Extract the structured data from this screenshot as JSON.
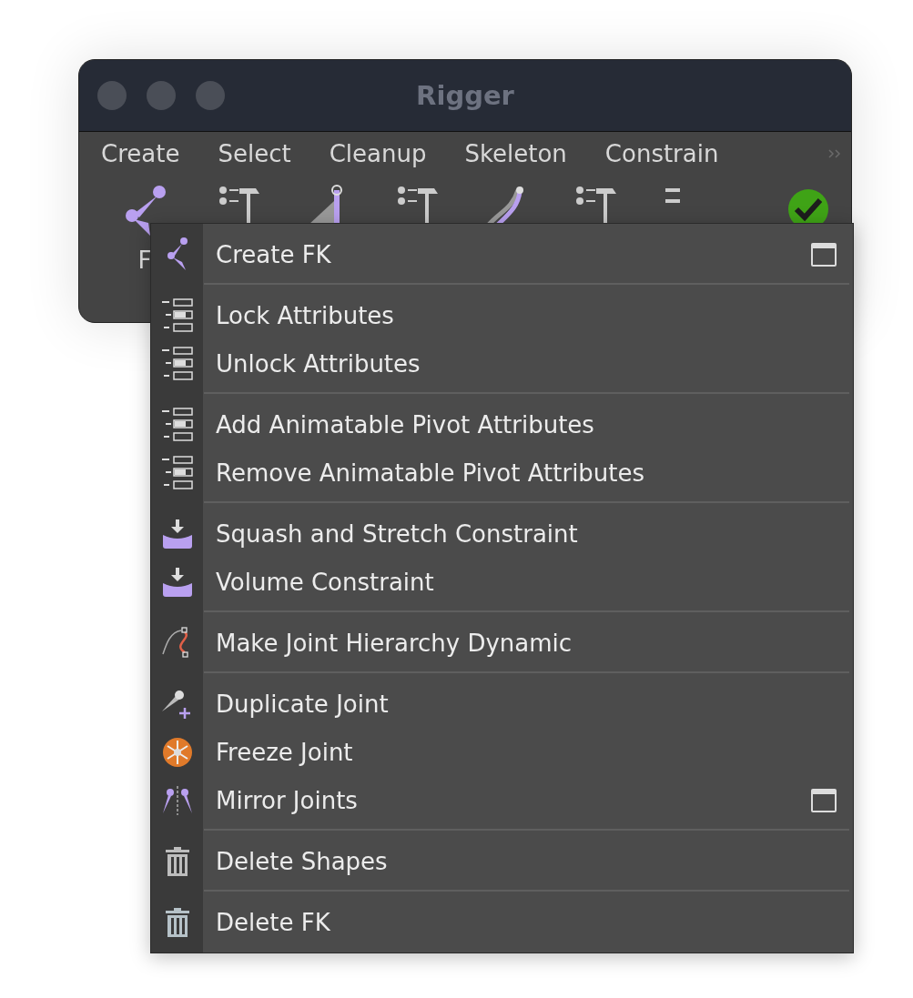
{
  "window": {
    "title": "Rigger"
  },
  "menu_bar": [
    "Create",
    "Select",
    "Cleanup",
    "Skeleton",
    "Constrain"
  ],
  "shelf": {
    "tools": [
      {
        "kind": "joint-chain",
        "label": "F"
      },
      {
        "kind": "attribute-tool"
      },
      {
        "kind": "joint-bone"
      },
      {
        "kind": "attribute-tool"
      },
      {
        "kind": "curve-bone"
      },
      {
        "kind": "attribute-tool"
      },
      {
        "kind": "bars"
      },
      {
        "kind": "check"
      }
    ]
  },
  "popup_menu": {
    "sections": [
      [
        {
          "label": "Create FK",
          "kind": "fk",
          "option_box": true
        }
      ],
      [
        {
          "label": "Lock Attributes",
          "kind": "attributes",
          "option_box": false
        },
        {
          "label": "Unlock Attributes",
          "kind": "attributes",
          "option_box": false
        }
      ],
      [
        {
          "label": "Add Animatable Pivot Attributes",
          "kind": "attributes",
          "option_box": false
        },
        {
          "label": "Remove Animatable Pivot Attributes",
          "kind": "attributes",
          "option_box": false
        }
      ],
      [
        {
          "label": "Squash and Stretch Constraint",
          "kind": "squash",
          "option_box": false
        },
        {
          "label": "Volume Constraint",
          "kind": "squash",
          "option_box": false
        }
      ],
      [
        {
          "label": "Make Joint Hierarchy Dynamic",
          "kind": "dynamic",
          "option_box": false
        }
      ],
      [
        {
          "label": "Duplicate Joint",
          "kind": "duplicate",
          "option_box": false
        },
        {
          "label": "Freeze Joint",
          "kind": "freeze",
          "option_box": false
        },
        {
          "label": "Mirror Joints",
          "kind": "mirror",
          "option_box": true
        }
      ],
      [
        {
          "label": "Delete Shapes",
          "kind": "trash",
          "option_box": false
        }
      ],
      [
        {
          "label": "Delete FK",
          "kind": "trash-light",
          "option_box": false
        }
      ]
    ]
  }
}
